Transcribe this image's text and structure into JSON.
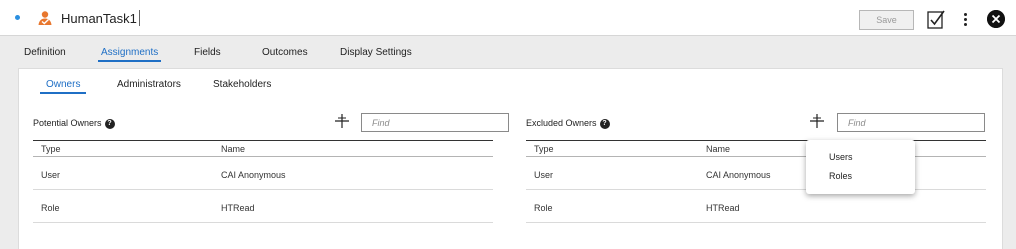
{
  "header": {
    "title": "HumanTask1",
    "save_label": "Save"
  },
  "main_tabs": [
    {
      "label": "Definition"
    },
    {
      "label": "Assignments",
      "active": true
    },
    {
      "label": "Fields"
    },
    {
      "label": "Outcomes"
    },
    {
      "label": "Display Settings"
    }
  ],
  "sub_tabs": [
    {
      "label": "Owners",
      "active": true
    },
    {
      "label": "Administrators"
    },
    {
      "label": "Stakeholders"
    }
  ],
  "potential_owners": {
    "title": "Potential Owners",
    "search_placeholder": "Find",
    "columns": [
      "Type",
      "Name"
    ],
    "rows": [
      {
        "type": "User",
        "name": "CAI Anonymous"
      },
      {
        "type": "Role",
        "name": "HTRead"
      }
    ]
  },
  "excluded_owners": {
    "title": "Excluded Owners",
    "search_placeholder": "Find",
    "columns": [
      "Type",
      "Name"
    ],
    "rows": [
      {
        "type": "User",
        "name": "CAI Anonymous"
      },
      {
        "type": "Role",
        "name": "HTRead"
      }
    ]
  },
  "add_menu": {
    "options": [
      "Users",
      "Roles"
    ]
  },
  "colors": {
    "accent": "#1f6fc5",
    "task_icon": "#e8772e",
    "status_dot": "#2b8fe0"
  },
  "icons": {
    "task": "human-task-icon",
    "help": "help-icon",
    "add": "add-icon",
    "check": "validate-icon",
    "more": "more-icon",
    "close": "close-icon"
  }
}
